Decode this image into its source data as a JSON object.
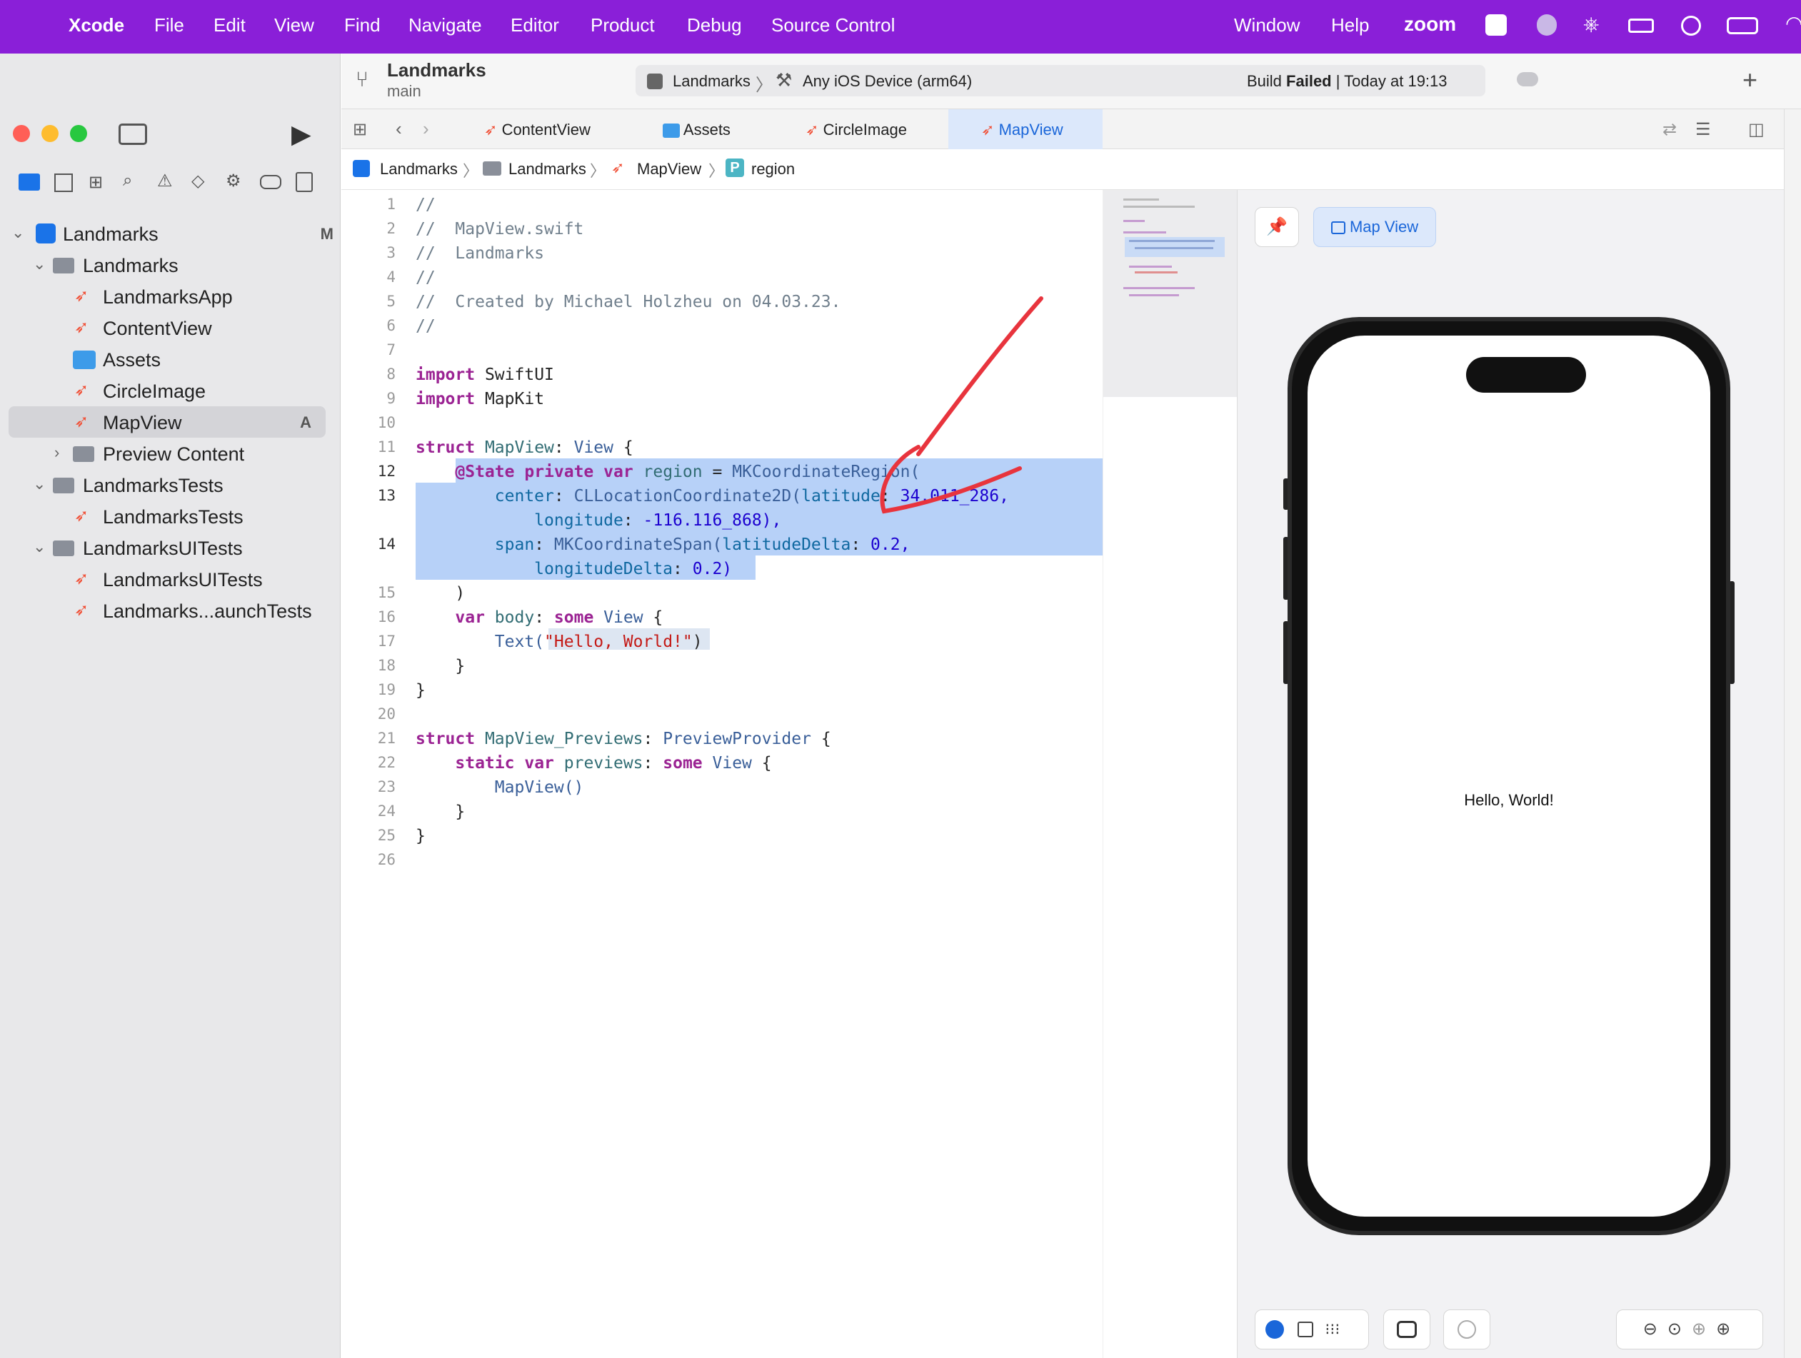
{
  "menubar": {
    "app": "Xcode",
    "items": [
      "File",
      "Edit",
      "View",
      "Find",
      "Navigate",
      "Editor",
      "Product",
      "Debug",
      "Source Control"
    ],
    "right_items": [
      "Window",
      "Help",
      "zoom"
    ]
  },
  "toolbar": {
    "project": "Landmarks",
    "branch": "main",
    "scheme": "Landmarks",
    "destination": "Any iOS Device (arm64)",
    "status_prefix": "Build",
    "status_word": "Failed",
    "status_time": "| Today at 19:13",
    "add": "+"
  },
  "navigator": {
    "items": [
      {
        "label": "Landmarks",
        "badge": "M"
      },
      {
        "label": "Landmarks",
        "badge": ""
      },
      {
        "label": "LandmarksApp",
        "badge": ""
      },
      {
        "label": "ContentView",
        "badge": ""
      },
      {
        "label": "Assets",
        "badge": ""
      },
      {
        "label": "CircleImage",
        "badge": ""
      },
      {
        "label": "MapView",
        "badge": "A"
      },
      {
        "label": "Preview Content",
        "badge": ""
      },
      {
        "label": "LandmarksTests",
        "badge": ""
      },
      {
        "label": "LandmarksTests",
        "badge": ""
      },
      {
        "label": "LandmarksUITests",
        "badge": ""
      },
      {
        "label": "LandmarksUITests",
        "badge": ""
      },
      {
        "label": "Landmarks...aunchTests",
        "badge": ""
      }
    ]
  },
  "tabs": [
    "ContentView",
    "Assets",
    "CircleImage",
    "MapView"
  ],
  "jumpbar": [
    "Landmarks",
    "Landmarks",
    "MapView",
    "region"
  ],
  "jumpbar_badge": "P",
  "line_numbers": [
    "1",
    "2",
    "3",
    "4",
    "5",
    "6",
    "7",
    "8",
    "9",
    "10",
    "11",
    "12",
    "13",
    "",
    "14",
    "",
    "15",
    "16",
    "17",
    "18",
    "19",
    "20",
    "21",
    "22",
    "23",
    "24",
    "25",
    "26"
  ],
  "code": {
    "l1": "//",
    "l2": "//  MapView.swift",
    "l3": "//  Landmarks",
    "l4": "//",
    "l5": "//  Created by Michael Holzheu on 04.03.23.",
    "l6": "//",
    "import_kw": "import",
    "swiftui": "SwiftUI",
    "mapkit": "MapKit",
    "struct_kw": "struct",
    "mapview": "MapView",
    "colon": ":",
    "view": "View",
    "brace_open": "{",
    "state": "@State",
    "private_kw": "private",
    "var_kw": "var",
    "region": "region",
    "eq": "=",
    "mkregion": "MKCoordinateRegion(",
    "center": "center",
    "cllc": "CLLocationCoordinate2D(",
    "latitude": "latitude",
    "lat_val": "34.011_286,",
    "longitude": "longitude",
    "lon_val": "-116.116_868),",
    "span": "span",
    "mkspan": "MKCoordinateSpan(",
    "latdelta": "latitudeDelta",
    "latdelta_val": "0.2,",
    "londelta": "longitudeDelta",
    "londelta_val": "0.2)",
    "paren_close": ")",
    "body": "body",
    "some_kw": "some",
    "text_fn": "Text(",
    "hello": "\"Hello, World!\"",
    "brace_close": "}",
    "previews_struct": "MapView_Previews",
    "preview_provider": "PreviewProvider",
    "static_kw": "static",
    "previews": "previews",
    "mapview_call": "MapView()"
  },
  "preview": {
    "label": "Map View",
    "text": "Hello, World!"
  },
  "colors": {
    "menubar": "#8a1fd8",
    "selection": "#b7d1f8",
    "accent": "#1a66d9",
    "annotation": "#e8343d"
  }
}
